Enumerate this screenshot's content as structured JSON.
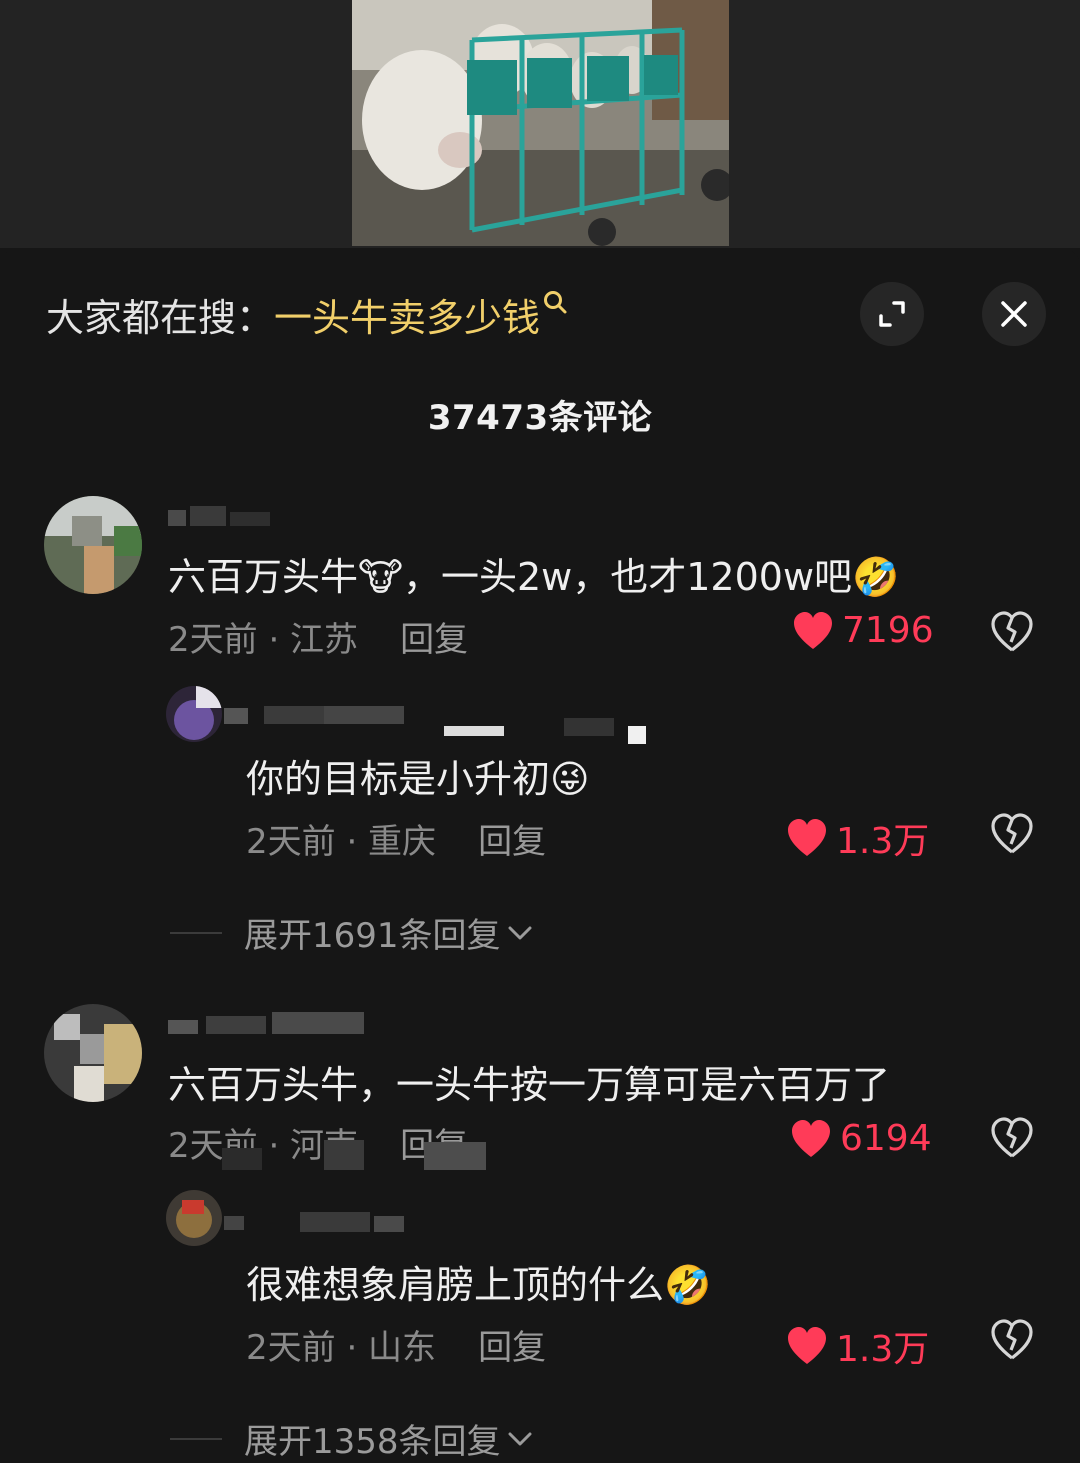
{
  "header": {
    "search_prefix": "大家都在搜：",
    "search_keyword": "一头牛卖多少钱",
    "icons": {
      "search": "search-icon",
      "expand": "expand-icon",
      "close": "close-icon"
    }
  },
  "comments_title": "37473条评论",
  "colors": {
    "keyword": "#f1cf6a",
    "like": "#ff3b58",
    "background": "#161616"
  },
  "comments": [
    {
      "text": "六百万头牛🐮，一头2w，也才1200w吧🤣",
      "meta": "2天前 · 江苏",
      "reply_label": "回复",
      "likes": "7196",
      "replies": [
        {
          "text": "你的目标是小升初😜",
          "meta": "2天前 · 重庆",
          "reply_label": "回复",
          "likes": "1.3万"
        }
      ],
      "expand_label": "展开1691条回复"
    },
    {
      "text": "六百万头牛，一头牛按一万算可是六百万了",
      "meta": "2天前 · 河南",
      "reply_label": "回复",
      "likes": "6194",
      "replies": [
        {
          "text": "很难想象肩膀上顶的什么🤣",
          "meta": "2天前 · 山东",
          "reply_label": "回复",
          "likes": "1.3万"
        }
      ],
      "expand_label": "展开1358条回复"
    }
  ]
}
